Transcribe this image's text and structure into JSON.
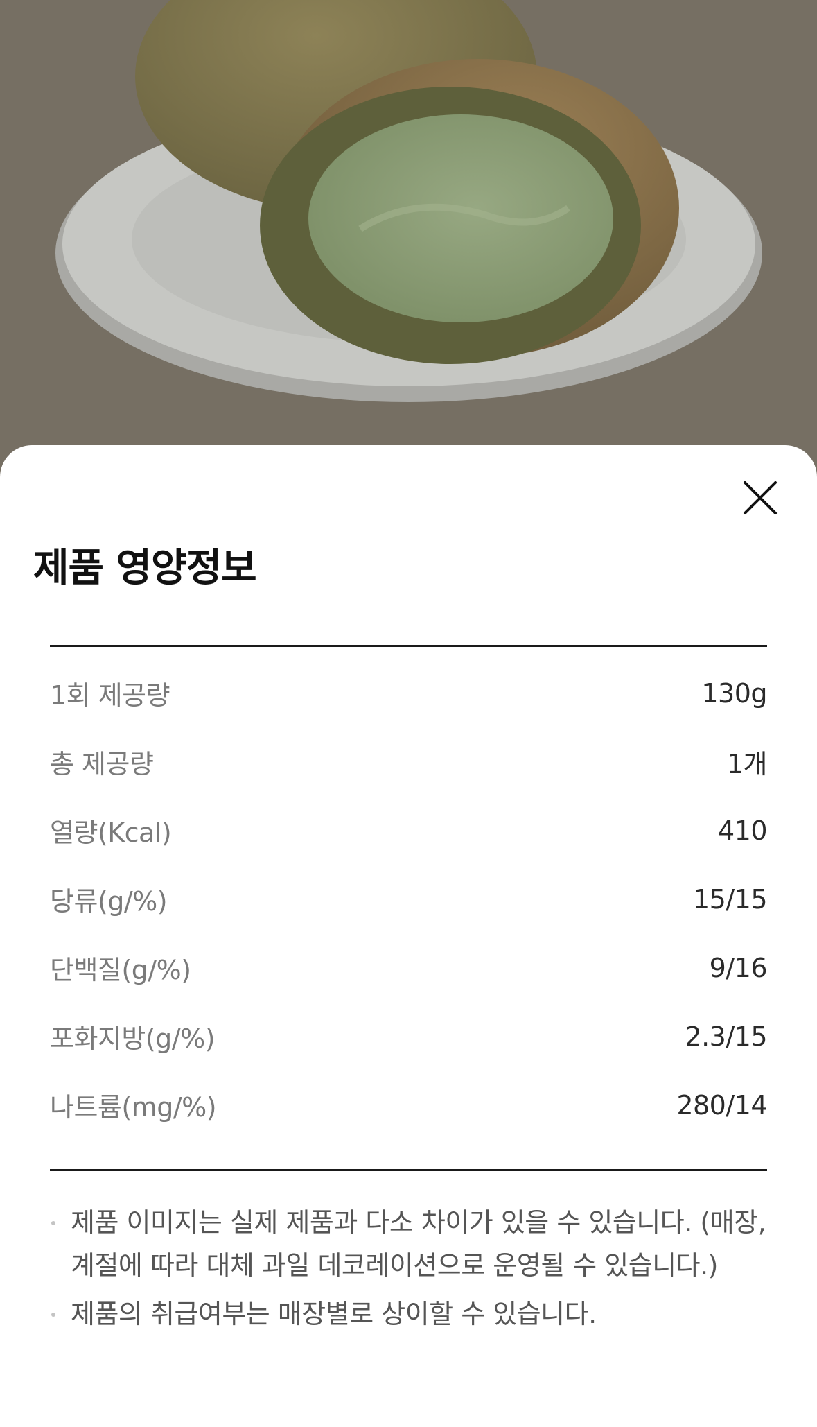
{
  "photo": {
    "icon": "product-photo",
    "colors": {
      "background": "#766f63",
      "plate": "#c9cac7",
      "bun_crust": "#8a7a52",
      "cream": "#8c9f78"
    }
  },
  "sheet": {
    "title": "제품 영양정보",
    "close_icon": "close-icon",
    "nutrition": [
      {
        "label": "1회 제공량",
        "value": "130g"
      },
      {
        "label": "총 제공량",
        "value": "1개"
      },
      {
        "label": "열량(Kcal)",
        "value": "410"
      },
      {
        "label": "당류(g/%)",
        "value": "15/15"
      },
      {
        "label": "단백질(g/%)",
        "value": "9/16"
      },
      {
        "label": "포화지방(g/%)",
        "value": "2.3/15"
      },
      {
        "label": "나트륨(mg/%)",
        "value": "280/14"
      }
    ],
    "notes": [
      "제품 이미지는 실제 제품과 다소 차이가 있을 수 있습니다. (매장, 계절에 따라 대체 과일 데코레이션으로 운영될 수 있습니다.)",
      "제품의 취급여부는 매장별로 상이할 수 있습니다."
    ]
  }
}
